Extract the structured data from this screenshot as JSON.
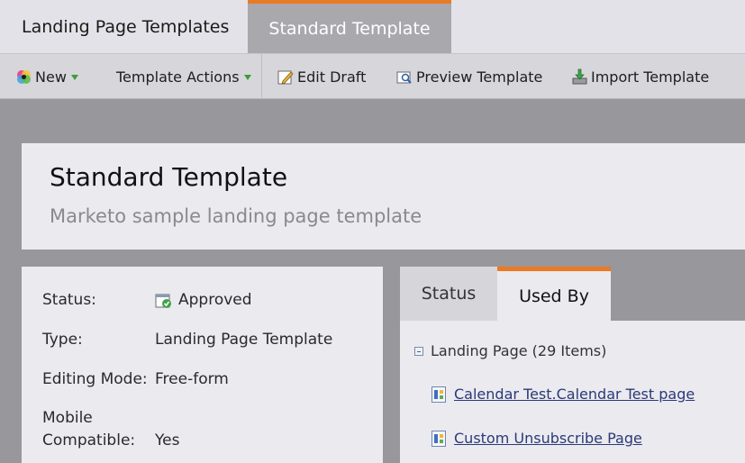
{
  "tabs": [
    {
      "label": "Landing Page Templates",
      "active": false
    },
    {
      "label": "Standard Template",
      "active": true
    }
  ],
  "toolbar": {
    "new_label": "New",
    "template_actions_label": "Template Actions",
    "edit_draft_label": "Edit Draft",
    "preview_label": "Preview Template",
    "import_label": "Import Template"
  },
  "header": {
    "title": "Standard Template",
    "description": "Marketo sample landing page template"
  },
  "info": {
    "status_label": "Status:",
    "status_value": "Approved",
    "type_label": "Type:",
    "type_value": "Landing Page Template",
    "editing_mode_label": "Editing Mode:",
    "editing_mode_value": "Free-form",
    "mobile_label_line1": "Mobile",
    "mobile_label_line2": "Compatible:",
    "mobile_value": "Yes"
  },
  "right_panel": {
    "tabs": [
      {
        "label": "Status",
        "active": false
      },
      {
        "label": "Used By",
        "active": true
      }
    ],
    "tree_group": "Landing Page (29 Items)",
    "items": [
      {
        "label": "Calendar Test.Calendar Test page"
      },
      {
        "label": "Custom Unsubscribe Page"
      }
    ]
  },
  "colors": {
    "accent_orange": "#ea7a23",
    "background": "#98979c",
    "card": "#ebeaef"
  }
}
